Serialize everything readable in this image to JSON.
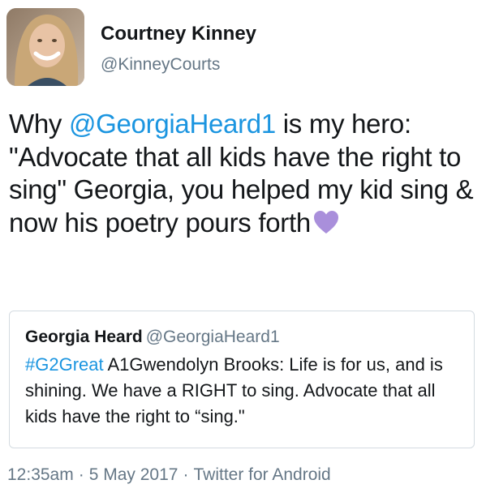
{
  "author": {
    "name": "Courtney Kinney",
    "handle": "@KinneyCourts"
  },
  "tweet": {
    "text_1": "Why ",
    "mention": "@GeorgiaHeard1",
    "text_2": " is my hero: \"Advocate that all kids have the right to sing\" Georgia, you helped my kid sing & now his poetry pours forth",
    "emoji": "purple-heart-icon",
    "emoji_color": "#a98fdb"
  },
  "quoted_tweet": {
    "name": "Georgia Heard",
    "handle": "@GeorgiaHeard1",
    "hashtag": "#G2Great",
    "text": " A1Gwendolyn Brooks: Life is for us, and is shining. We have a RIGHT to sing. Advocate that all kids have the right to “sing.\""
  },
  "meta": {
    "time": "12:35am",
    "separator": "·",
    "date": "5 May 2017",
    "source": "Twitter for Android"
  },
  "colors": {
    "link": "#1b95e0",
    "secondary_text": "#657786",
    "border": "#d4dbe1"
  }
}
